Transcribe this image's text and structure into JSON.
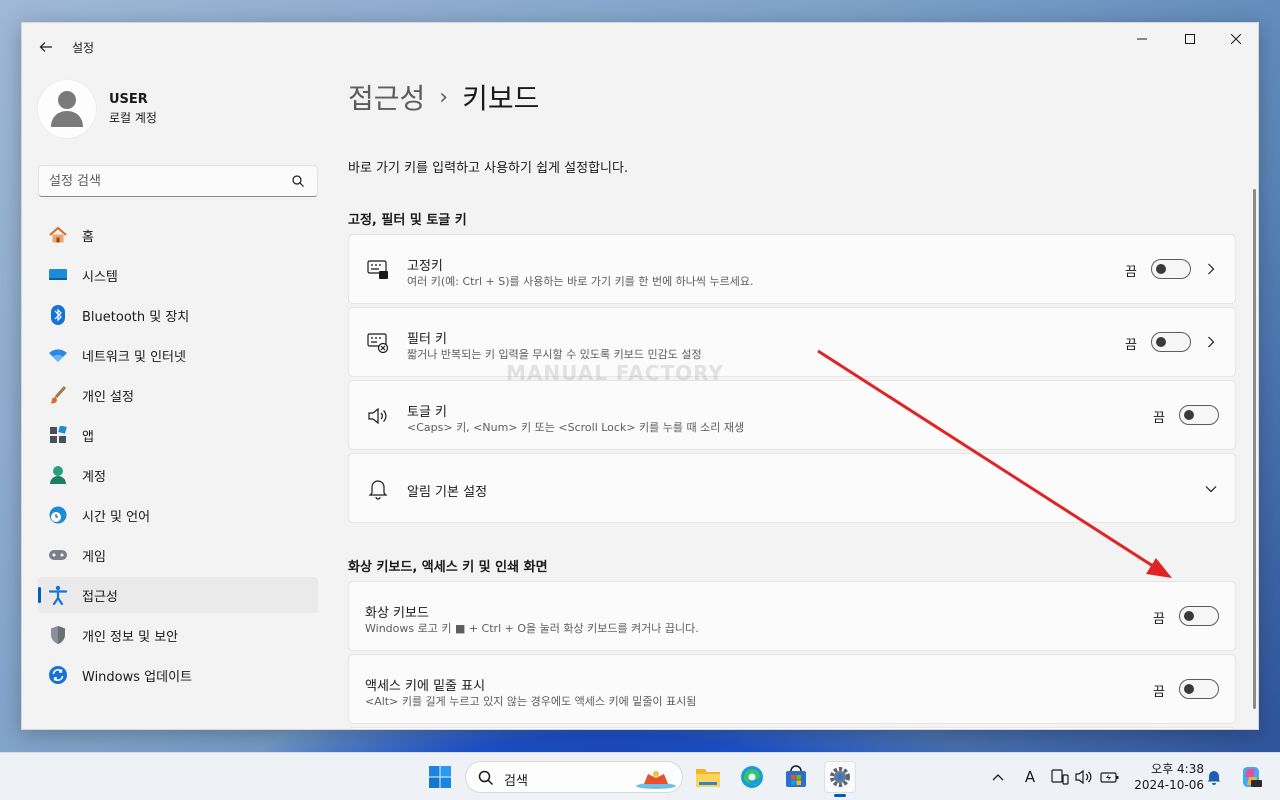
{
  "window": {
    "title": "설정"
  },
  "profile": {
    "name": "USER",
    "account_type": "로컬 계정"
  },
  "search": {
    "placeholder": "설정 검색"
  },
  "nav": [
    {
      "label": "홈",
      "icon": "home-icon"
    },
    {
      "label": "시스템",
      "icon": "system-icon"
    },
    {
      "label": "Bluetooth 및 장치",
      "icon": "bluetooth-icon"
    },
    {
      "label": "네트워크 및 인터넷",
      "icon": "network-icon"
    },
    {
      "label": "개인 설정",
      "icon": "brush-icon"
    },
    {
      "label": "앱",
      "icon": "apps-icon"
    },
    {
      "label": "계정",
      "icon": "account-icon"
    },
    {
      "label": "시간 및 언어",
      "icon": "time-language-icon"
    },
    {
      "label": "게임",
      "icon": "gaming-icon"
    },
    {
      "label": "접근성",
      "icon": "accessibility-icon",
      "active": true
    },
    {
      "label": "개인 정보 및 보안",
      "icon": "shield-icon"
    },
    {
      "label": "Windows 업데이트",
      "icon": "update-icon"
    }
  ],
  "breadcrumb": {
    "parent": "접근성",
    "separator": "›",
    "current": "키보드"
  },
  "page_description": "바로 가기 키를 입력하고 사용하기 쉽게 설정합니다.",
  "sections": [
    {
      "title": "고정, 필터 및 토글 키",
      "cards": [
        {
          "title": "고정키",
          "description": "여러 키(예: Ctrl + S)를 사용하는 바로 가기 키를 한 번에 하나씩 누르세요.",
          "state": "끔",
          "icon": "sticky-keys-icon",
          "chevron": true
        },
        {
          "title": "필터 키",
          "description": "짧거나 반복되는 키 입력을 무시할 수 있도록 키보드 민감도 설정",
          "state": "끔",
          "icon": "filter-keys-icon",
          "chevron": true
        },
        {
          "title": "토글 키",
          "description": "<Caps> 키, <Num> 키 또는 <Scroll Lock> 키를 누를 때 소리 재생",
          "state": "끔",
          "icon": "speaker-icon",
          "chevron": false
        },
        {
          "title": "알림 기본 설정",
          "icon": "bell-icon",
          "expand": true
        }
      ]
    },
    {
      "title": "화상 키보드, 액세스 키 및 인쇄 화면",
      "cards": [
        {
          "title": "화상 키보드",
          "description": "Windows 로고 키 ■ + Ctrl + O을 눌러 화상 키보드를 켜거나 끕니다.",
          "state": "끔"
        },
        {
          "title": "액세스 키에 밑줄 표시",
          "description": "<Alt> 키를 길게 누르고 있지 않는 경우에도 액세스 키에 밑줄이 표시됨",
          "state": "끔"
        }
      ]
    }
  ],
  "watermark": "MANUAL FACTORY",
  "annotation_color": "#e02424",
  "taskbar": {
    "search_label": "검색",
    "clock_ampm_time": "오후 4:38",
    "clock_date": "2024-10-06",
    "ime_label": "A"
  },
  "colors": {
    "accent": "#005fb8",
    "window_bg": "#f3f3f3",
    "card_bg": "#fbfbfb"
  }
}
